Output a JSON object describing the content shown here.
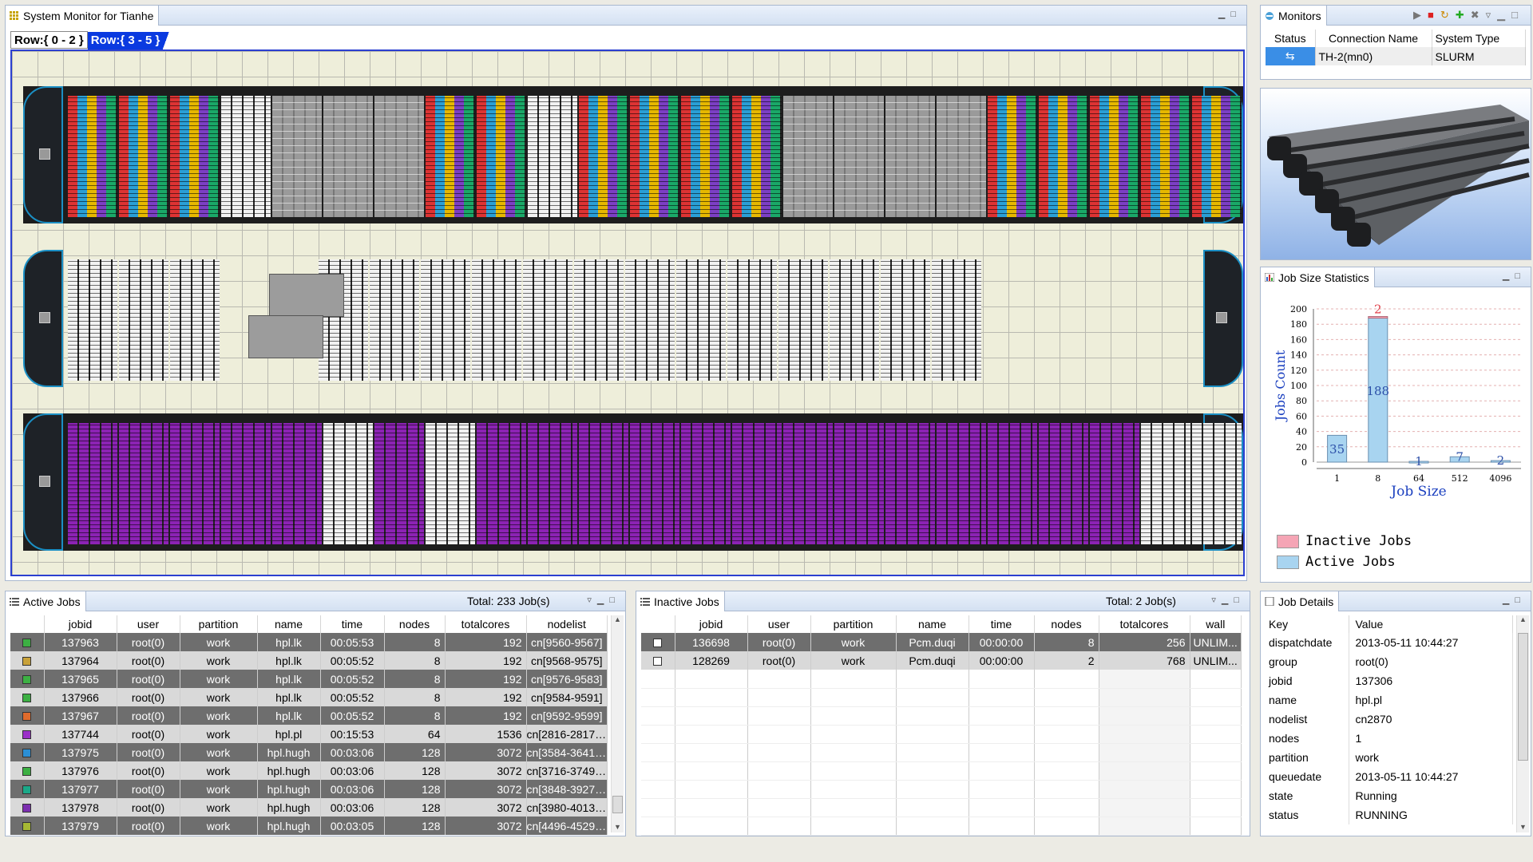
{
  "main_view": {
    "tab_label": "System Monitor for Tianhe",
    "row_tabs": [
      "Row:{ 0 - 2 }",
      "Row:{ 3 - 5 }"
    ]
  },
  "monitors": {
    "tab_label": "Monitors",
    "columns": [
      "Status",
      "Connection Name",
      "System Type"
    ],
    "rows": [
      {
        "status_icon": "connection-status-icon",
        "connection_name": "TH-2(mn0)",
        "system_type": "SLURM"
      }
    ]
  },
  "job_size": {
    "tab_label": "Job Size Statistics",
    "legend": [
      "Inactive Jobs",
      "Active Jobs"
    ]
  },
  "chart_data": {
    "type": "bar",
    "categories": [
      "1",
      "8",
      "64",
      "512",
      "4096"
    ],
    "series": [
      {
        "name": "Active Jobs",
        "values": [
          35,
          188,
          1,
          7,
          2
        ]
      },
      {
        "name": "Inactive Jobs",
        "values": [
          0,
          2,
          0,
          0,
          0
        ]
      }
    ],
    "stacked": true,
    "xlabel": "Job Size",
    "ylabel": "Jobs Count",
    "ylim": [
      0,
      200
    ],
    "yticks": [
      0,
      20,
      40,
      60,
      80,
      100,
      120,
      140,
      160,
      180,
      200
    ],
    "data_labels_active": [
      "35",
      "188",
      "1",
      "7",
      "2"
    ],
    "data_labels_inactive": [
      "",
      "2",
      "",
      "",
      ""
    ],
    "colors": {
      "active": "#a8d4f0",
      "inactive": "#f5a5b5"
    },
    "legend_position": "bottom-left"
  },
  "active_jobs": {
    "tab_label": "Active Jobs",
    "total": "Total: 233 Job(s)",
    "columns": [
      "",
      "jobid",
      "user",
      "partition",
      "name",
      "time",
      "nodes",
      "totalcores",
      "nodelist"
    ],
    "rows": [
      {
        "color": "#3cb043",
        "jobid": "137963",
        "user": "root(0)",
        "partition": "work",
        "name": "hpl.lk",
        "time": "00:05:53",
        "nodes": "8",
        "totalcores": "192",
        "nodelist": "cn[9560-9567]"
      },
      {
        "color": "#c9a23a",
        "jobid": "137964",
        "user": "root(0)",
        "partition": "work",
        "name": "hpl.lk",
        "time": "00:05:52",
        "nodes": "8",
        "totalcores": "192",
        "nodelist": "cn[9568-9575]"
      },
      {
        "color": "#3cb043",
        "jobid": "137965",
        "user": "root(0)",
        "partition": "work",
        "name": "hpl.lk",
        "time": "00:05:52",
        "nodes": "8",
        "totalcores": "192",
        "nodelist": "cn[9576-9583]"
      },
      {
        "color": "#3cb043",
        "jobid": "137966",
        "user": "root(0)",
        "partition": "work",
        "name": "hpl.lk",
        "time": "00:05:52",
        "nodes": "8",
        "totalcores": "192",
        "nodelist": "cn[9584-9591]"
      },
      {
        "color": "#e06b2c",
        "jobid": "137967",
        "user": "root(0)",
        "partition": "work",
        "name": "hpl.lk",
        "time": "00:05:52",
        "nodes": "8",
        "totalcores": "192",
        "nodelist": "cn[9592-9599]"
      },
      {
        "color": "#9b30c8",
        "jobid": "137744",
        "user": "root(0)",
        "partition": "work",
        "name": "hpl.pl",
        "time": "00:15:53",
        "nodes": "64",
        "totalcores": "1536",
        "nodelist": "cn[2816-2817,28..."
      },
      {
        "color": "#2a8fd6",
        "jobid": "137975",
        "user": "root(0)",
        "partition": "work",
        "name": "hpl.hugh",
        "time": "00:03:06",
        "nodes": "128",
        "totalcores": "3072",
        "nodelist": "cn[3584-3641,36..."
      },
      {
        "color": "#3cb043",
        "jobid": "137976",
        "user": "root(0)",
        "partition": "work",
        "name": "hpl.hugh",
        "time": "00:03:06",
        "nodes": "128",
        "totalcores": "3072",
        "nodelist": "cn[3716-3749,37..."
      },
      {
        "color": "#1aa888",
        "jobid": "137977",
        "user": "root(0)",
        "partition": "work",
        "name": "hpl.hugh",
        "time": "00:03:06",
        "nodes": "128",
        "totalcores": "3072",
        "nodelist": "cn[3848-3927,39..."
      },
      {
        "color": "#7c2fb0",
        "jobid": "137978",
        "user": "root(0)",
        "partition": "work",
        "name": "hpl.hugh",
        "time": "00:03:06",
        "nodes": "128",
        "totalcores": "3072",
        "nodelist": "cn[3980-4013,40..."
      },
      {
        "color": "#a6b834",
        "jobid": "137979",
        "user": "root(0)",
        "partition": "work",
        "name": "hpl.hugh",
        "time": "00:03:05",
        "nodes": "128",
        "totalcores": "3072",
        "nodelist": "cn[4496-4529,45..."
      }
    ]
  },
  "inactive_jobs": {
    "tab_label": "Inactive Jobs",
    "total": "Total: 2 Job(s)",
    "columns": [
      "",
      "jobid",
      "user",
      "partition",
      "name",
      "time",
      "nodes",
      "totalcores",
      "wall"
    ],
    "rows": [
      {
        "jobid": "136698",
        "user": "root(0)",
        "partition": "work",
        "name": "Pcm.duqi",
        "time": "00:00:00",
        "nodes": "8",
        "totalcores": "256",
        "wall": "UNLIM..."
      },
      {
        "jobid": "128269",
        "user": "root(0)",
        "partition": "work",
        "name": "Pcm.duqi",
        "time": "00:00:00",
        "nodes": "2",
        "totalcores": "768",
        "wall": "UNLIM..."
      }
    ]
  },
  "job_details": {
    "tab_label": "Job Details",
    "columns": [
      "Key",
      "Value"
    ],
    "rows": [
      {
        "key": "dispatchdate",
        "value": "2013-05-11 10:44:27"
      },
      {
        "key": "group",
        "value": "root(0)"
      },
      {
        "key": "jobid",
        "value": "137306"
      },
      {
        "key": "name",
        "value": "hpl.pl"
      },
      {
        "key": "nodelist",
        "value": "cn2870"
      },
      {
        "key": "nodes",
        "value": "1"
      },
      {
        "key": "partition",
        "value": "work"
      },
      {
        "key": "queuedate",
        "value": "2013-05-11 10:44:27"
      },
      {
        "key": "state",
        "value": "Running"
      },
      {
        "key": "status",
        "value": "RUNNING"
      }
    ]
  }
}
